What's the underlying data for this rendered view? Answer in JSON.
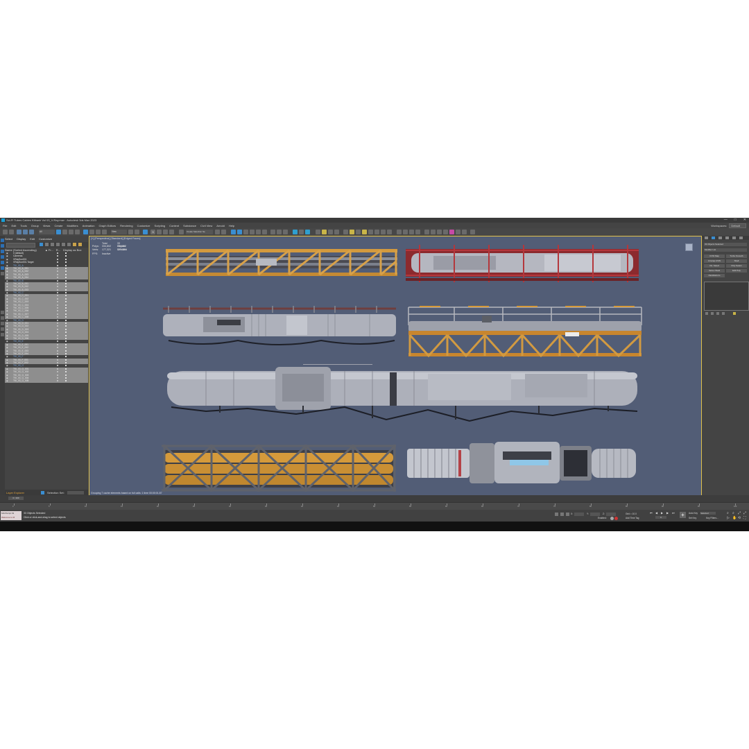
{
  "window": {
    "title": "Sci-Fi Tubes Cables Kitbash Vol 03_V-Ray.max - Autodesk 3ds Max 2023",
    "buttons": [
      "—",
      "□",
      "✕"
    ]
  },
  "menu": {
    "items": [
      "File",
      "Edit",
      "Tools",
      "Group",
      "Views",
      "Create",
      "Modifiers",
      "Animation",
      "Graph Editors",
      "Rendering",
      "Customize",
      "Scripting",
      "Content",
      "Substance",
      "Civil View",
      "Arnold",
      "Help"
    ],
    "workspaces_label": "Workspaces:",
    "workspaces_value": "Default"
  },
  "toolbar": {
    "selection_filter": "All",
    "view_dropdown": "View",
    "named_selection": "Create Selection Se",
    "angle_snap": "3"
  },
  "scene_explorer": {
    "tabs": [
      "Select",
      "Display",
      "Edit",
      "Customize"
    ],
    "columns": [
      "Name (Sorted Ascending)",
      "▲ Fr...",
      "R...",
      "Display as Box"
    ],
    "rows": [
      {
        "name": "0 (default)",
        "type": "layer"
      },
      {
        "name": "Cameras",
        "type": "item"
      },
      {
        "name": "VRaySun001",
        "type": "item"
      },
      {
        "name": "VRaySun001.Target",
        "type": "item"
      },
      {
        "name": "TKI_03_A",
        "type": "group"
      },
      {
        "name": "TKI_03_A_001",
        "type": "sel"
      },
      {
        "name": "TKI_03_A_002",
        "type": "sel"
      },
      {
        "name": "TKI_03_A_003",
        "type": "sel"
      },
      {
        "name": "TKI_03_A_004",
        "type": "sel"
      },
      {
        "name": "TKI_03_B",
        "type": "group"
      },
      {
        "name": "TKI_03_B_001",
        "type": "sel"
      },
      {
        "name": "TKI_03_B_002",
        "type": "sel"
      },
      {
        "name": "TKI_03_B_003",
        "type": "sel"
      },
      {
        "name": "TKI_03_C",
        "type": "group"
      },
      {
        "name": "TKI_03_C_001",
        "type": "sel"
      },
      {
        "name": "TKI_03_C_002",
        "type": "sel"
      },
      {
        "name": "TKI_03_C_003",
        "type": "sel"
      },
      {
        "name": "TKI_03_C_004",
        "type": "sel"
      },
      {
        "name": "TKI_03_C_005",
        "type": "sel"
      },
      {
        "name": "TKI_03_C_006",
        "type": "sel"
      },
      {
        "name": "TKI_03_C_007",
        "type": "sel"
      },
      {
        "name": "TKI_03_C_008",
        "type": "sel"
      },
      {
        "name": "TKI_03_D",
        "type": "group"
      },
      {
        "name": "TKI_03_D_001",
        "type": "sel"
      },
      {
        "name": "TKI_03_D_002",
        "type": "sel"
      },
      {
        "name": "TKI_03_D_003",
        "type": "sel"
      },
      {
        "name": "TKI_03_D_004",
        "type": "sel"
      },
      {
        "name": "TKI_03_D_005",
        "type": "sel"
      },
      {
        "name": "TKI_03_D_006",
        "type": "sel"
      },
      {
        "name": "TKI_03_E",
        "type": "group"
      },
      {
        "name": "TKI_03_E_001",
        "type": "sel"
      },
      {
        "name": "TKI_03_E_002",
        "type": "sel"
      },
      {
        "name": "TKI_03_E_003",
        "type": "sel"
      },
      {
        "name": "TKI_03_E_004",
        "type": "sel"
      },
      {
        "name": "TKI_03_F",
        "type": "group"
      },
      {
        "name": "TKI_03_F_001",
        "type": "sel"
      },
      {
        "name": "TKI_03_F_002",
        "type": "sel"
      },
      {
        "name": "TKI_03_G",
        "type": "group"
      },
      {
        "name": "TKI_03_G_001",
        "type": "sel"
      },
      {
        "name": "TKI_03_G_002",
        "type": "sel"
      },
      {
        "name": "TKI_03_G_003",
        "type": "sel"
      },
      {
        "name": "TKI_03_G_004",
        "type": "sel"
      },
      {
        "name": "TKI_03_G_005",
        "type": "sel"
      }
    ],
    "footer_label": "Layer Explorer",
    "footer_selection": "Selection Set:"
  },
  "viewport": {
    "label": "[+] [Perspective] [Standard] [Edged Faces]",
    "stats": {
      "header_total": "Total",
      "header_sel": "33 Objects Selected",
      "polys_label": "Polys:",
      "polys_total": "334,802",
      "polys_sel": "334,802",
      "verts_label": "Verts:",
      "verts_total": "177,321",
      "verts_sel": "177,321",
      "fps_label": "FPS:",
      "fps_value": "Inactive"
    },
    "status": "Grouping 7 cache elements based on full calls: 1 time 00:00:01.87"
  },
  "command_panel": {
    "object_name": "33 Objects Selected",
    "modifier_list": "Modifier List",
    "buttons": [
      "UVW Map",
      "Turbo Smooth",
      "Unwrap UVW",
      "Shell",
      "Vol. Select",
      "Poly Select",
      "Vertex Weld",
      "Edit Poly",
      "PaintDeform"
    ]
  },
  "timeline": {
    "frame_display": "0 / 100",
    "ticks": [
      "0",
      "5",
      "10",
      "15",
      "20",
      "25",
      "30",
      "35",
      "40",
      "45",
      "50",
      "55",
      "60",
      "65",
      "70",
      "75",
      "80",
      "85",
      "90",
      "95",
      "100"
    ]
  },
  "statusbar": {
    "maxscript_line1": "MAXScript Mi",
    "maxscript_line2": "Welcome to M",
    "message1": "33 Objects Selected",
    "message2": "Click or click-and-drag to select objects",
    "x_label": "X:",
    "y_label": "Y:",
    "z_label": "Z:",
    "grid": "Grid = 10.0",
    "enabled": "Enabled:",
    "add_time_tag": "Add Time Tag",
    "auto_key": "Auto Key",
    "set_key": "Set Key",
    "selected": "Selected",
    "key_filters": "Key Filters...",
    "frame": "0"
  },
  "accent_colors": {
    "viewport_bg": "#525d76",
    "active_border": "#e2c24a",
    "selection_row": "#8e8e8e",
    "group_text": "#7aa7e0"
  }
}
